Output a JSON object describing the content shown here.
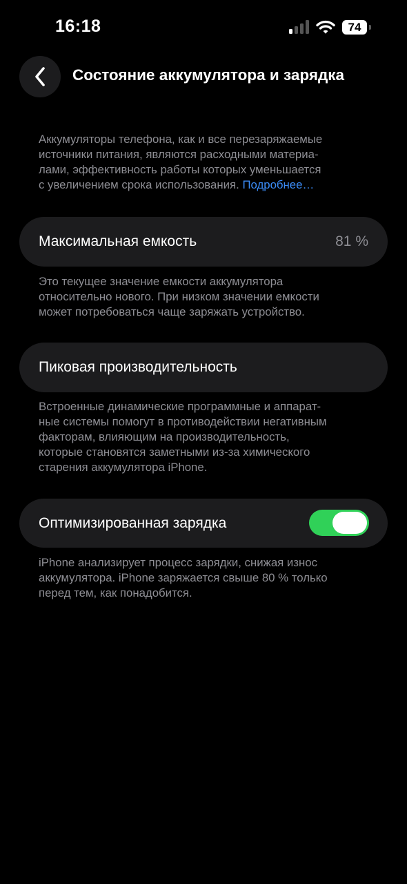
{
  "status_bar": {
    "time": "16:18",
    "battery_level": "74",
    "signal_bars_filled": 1,
    "signal_bars_total": 4
  },
  "nav": {
    "back_icon": "chevron-left-icon",
    "title": "Состояние аккумулятора и зарядка"
  },
  "intro": {
    "lines": [
      "Аккумуляторы телефона, как и все перезаряжаемые",
      "источники питания, являются расходными материа-",
      "лами, эффективность работы которых уменьшается",
      "с увеличением срока использования."
    ],
    "link": "Подробнее…"
  },
  "max_capacity": {
    "label": "Максимальная емкость",
    "value": "81 %",
    "footnote": [
      "Это текущее значение емкости аккумулятора",
      "относительно нового. При низком значении емкости",
      "может потребоваться чаще заряжать устройство."
    ]
  },
  "peak_performance": {
    "label": "Пиковая производительность",
    "footnote": [
      "Встроенные динамические программные и аппарат-",
      "ные системы помогут в противодействии негативным",
      "факторам, влияющим на производительность,",
      "которые становятся заметными из-за химического",
      "старения аккумулятора iPhone."
    ]
  },
  "optimized_charging": {
    "label": "Оптимизированная зарядка",
    "enabled": true,
    "footnote": [
      "iPhone анализирует процесс зарядки, снижая износ",
      "аккумулятора. iPhone заряжается свыше 80 % только",
      "перед тем, как понадобится."
    ]
  },
  "colors": {
    "background": "#000000",
    "card": "#1c1c1e",
    "secondary_text": "#8d8d93",
    "link": "#3b8cf7",
    "toggle_on": "#30d158"
  }
}
